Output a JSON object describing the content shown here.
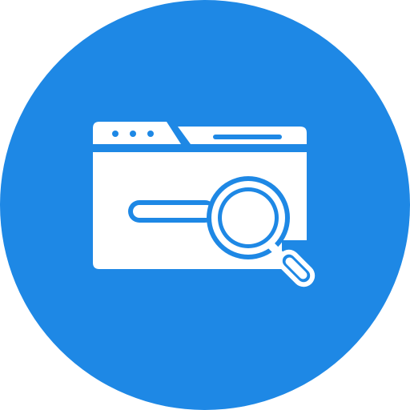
{
  "icon": {
    "name": "browser-search-icon",
    "colors": {
      "background": "#ffffff",
      "circle": "#1e88e5",
      "glyph": "#ffffff"
    }
  }
}
